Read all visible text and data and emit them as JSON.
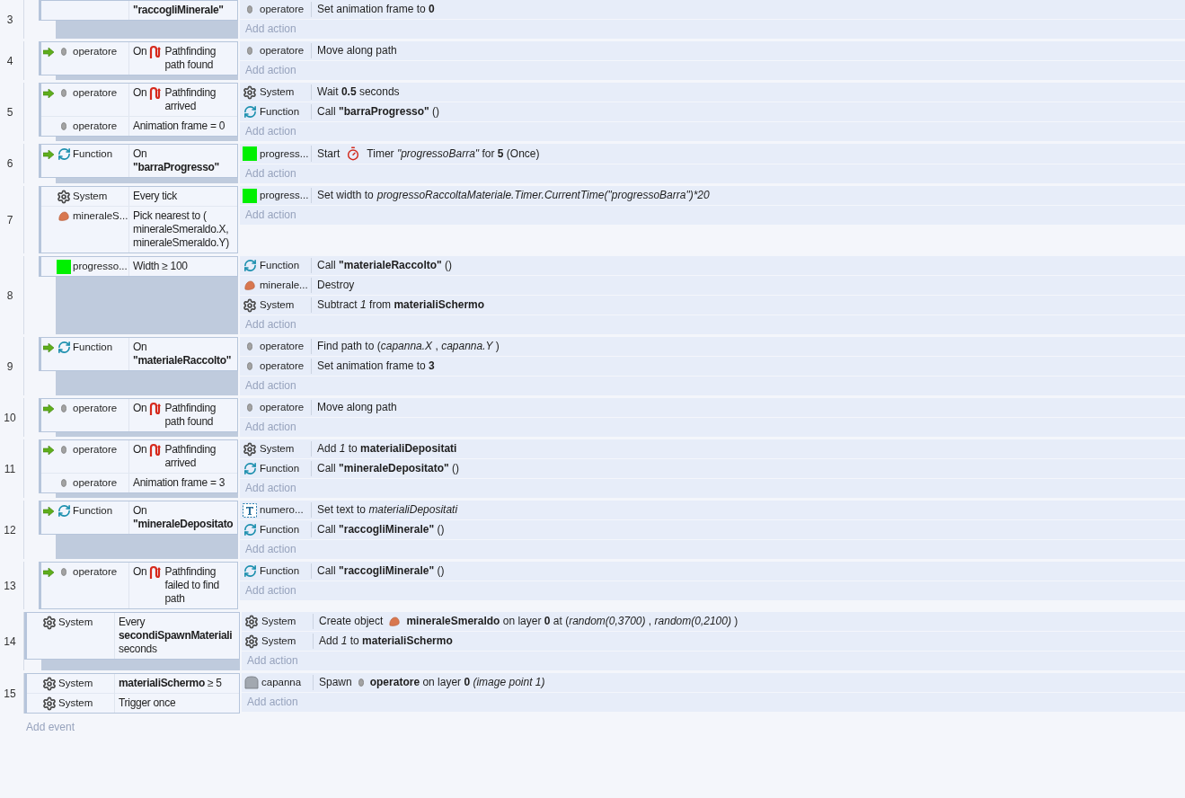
{
  "sub_events": [
    {
      "number": "3",
      "trigger": false,
      "conditions": [
        {
          "segments": [
            {
              "kind": "text",
              "text": "**\"raccogliMinerale\"**"
            }
          ]
        }
      ],
      "actions": [
        {
          "kind": "sprite",
          "object": "operatore",
          "segments": [
            {
              "kind": "text",
              "text": "Set animation frame to **0**"
            }
          ]
        }
      ],
      "add_action": "Add action"
    },
    {
      "number": "4",
      "trigger": true,
      "conditions": [
        {
          "kind": "sprite",
          "object": "operatore",
          "segments": [
            {
              "kind": "text",
              "text": "On"
            },
            {
              "kind": "pathfinding"
            },
            {
              "kind": "text",
              "text": "Pathfinding path found"
            }
          ]
        }
      ],
      "actions": [
        {
          "kind": "sprite",
          "object": "operatore",
          "segments": [
            {
              "kind": "text",
              "text": "Move along path"
            }
          ]
        }
      ],
      "add_action": "Add action"
    },
    {
      "number": "5",
      "trigger": true,
      "conditions": [
        {
          "kind": "sprite",
          "object": "operatore",
          "segments": [
            {
              "kind": "text",
              "text": "On"
            },
            {
              "kind": "pathfinding"
            },
            {
              "kind": "text",
              "text": "Pathfinding arrived"
            }
          ]
        },
        {
          "kind": "sprite",
          "object": "operatore",
          "segments": [
            {
              "kind": "text",
              "text": "Animation frame = 0"
            }
          ]
        }
      ],
      "actions": [
        {
          "kind": "system",
          "object": "System",
          "segments": [
            {
              "kind": "text",
              "text": "Wait **0.5** seconds"
            }
          ]
        },
        {
          "kind": "function",
          "object": "Function",
          "segments": [
            {
              "kind": "text",
              "text": "Call **\"barraProgresso\"** ()"
            }
          ]
        }
      ],
      "add_action": "Add action"
    },
    {
      "number": "6",
      "trigger": true,
      "conditions": [
        {
          "kind": "function",
          "object": "Function",
          "segments": [
            {
              "kind": "text",
              "text": "On **\"barraProgresso\"**"
            }
          ]
        }
      ],
      "actions": [
        {
          "kind": "bar",
          "object": "progress...",
          "segments": [
            {
              "kind": "text",
              "text": "Start"
            },
            {
              "kind": "timer"
            },
            {
              "kind": "text",
              "text": "Timer *\"progressoBarra\"* for **5** (Once)"
            }
          ]
        }
      ],
      "add_action": "Add action"
    },
    {
      "number": "7",
      "trigger": false,
      "conditions": [
        {
          "kind": "system",
          "object": "System",
          "segments": [
            {
              "kind": "text",
              "text": "Every tick"
            }
          ]
        },
        {
          "kind": "mineral",
          "object": "mineraleS...",
          "segments": [
            {
              "kind": "text",
              "text": "Pick nearest to ( mineraleSmeraldo.X, mineraleSmeraldo.Y)"
            }
          ]
        }
      ],
      "actions": [
        {
          "kind": "bar",
          "object": "progress...",
          "segments": [
            {
              "kind": "text",
              "text": "Set width to"
            },
            {
              "kind": "expr",
              "text": "progressoRaccoltaMateriale.Timer.CurrentTime(\"progressoBarra\")*20"
            }
          ]
        }
      ],
      "add_action": "Add action"
    },
    {
      "number": "8",
      "trigger": false,
      "conditions": [
        {
          "kind": "bar",
          "object": "progresso...",
          "segments": [
            {
              "kind": "text",
              "text": "Width ≥ 100"
            }
          ]
        }
      ],
      "actions": [
        {
          "kind": "function",
          "object": "Function",
          "segments": [
            {
              "kind": "text",
              "text": "Call **\"materialeRaccolto\"** ()"
            }
          ]
        },
        {
          "kind": "mineral",
          "object": "minerale...",
          "segments": [
            {
              "kind": "text",
              "text": "Destroy"
            }
          ]
        },
        {
          "kind": "system",
          "object": "System",
          "segments": [
            {
              "kind": "text",
              "text": "Subtract *1* from **materialiSchermo**"
            }
          ]
        }
      ],
      "add_action": "Add action"
    },
    {
      "number": "9",
      "trigger": true,
      "conditions": [
        {
          "kind": "function",
          "object": "Function",
          "segments": [
            {
              "kind": "text",
              "text": "On **\"materialeRaccolto\"**"
            }
          ]
        }
      ],
      "actions": [
        {
          "kind": "sprite",
          "object": "operatore",
          "segments": [
            {
              "kind": "text",
              "text": "Find path to (*capanna.X* , *capanna.Y* )"
            }
          ]
        },
        {
          "kind": "sprite",
          "object": "operatore",
          "segments": [
            {
              "kind": "text",
              "text": "Set animation frame to **3**"
            }
          ]
        }
      ],
      "add_action": "Add action"
    },
    {
      "number": "10",
      "trigger": true,
      "conditions": [
        {
          "kind": "sprite",
          "object": "operatore",
          "segments": [
            {
              "kind": "text",
              "text": "On"
            },
            {
              "kind": "pathfinding"
            },
            {
              "kind": "text",
              "text": "Pathfinding path found"
            }
          ]
        }
      ],
      "actions": [
        {
          "kind": "sprite",
          "object": "operatore",
          "segments": [
            {
              "kind": "text",
              "text": "Move along path"
            }
          ]
        }
      ],
      "add_action": "Add action"
    },
    {
      "number": "11",
      "trigger": true,
      "conditions": [
        {
          "kind": "sprite",
          "object": "operatore",
          "segments": [
            {
              "kind": "text",
              "text": "On"
            },
            {
              "kind": "pathfinding"
            },
            {
              "kind": "text",
              "text": "Pathfinding arrived"
            }
          ]
        },
        {
          "kind": "sprite",
          "object": "operatore",
          "segments": [
            {
              "kind": "text",
              "text": "Animation frame = 3"
            }
          ]
        }
      ],
      "actions": [
        {
          "kind": "system",
          "object": "System",
          "segments": [
            {
              "kind": "text",
              "text": "Add *1* to **materialiDepositati**"
            }
          ]
        },
        {
          "kind": "function",
          "object": "Function",
          "segments": [
            {
              "kind": "text",
              "text": "Call **\"mineraleDepositato\"** ()"
            }
          ]
        }
      ],
      "add_action": "Add action"
    },
    {
      "number": "12",
      "trigger": true,
      "conditions": [
        {
          "kind": "function",
          "object": "Function",
          "segments": [
            {
              "kind": "text",
              "text": "On **\"mineraleDepositato**"
            }
          ]
        }
      ],
      "actions": [
        {
          "kind": "textobj",
          "object": "numero...",
          "segments": [
            {
              "kind": "text",
              "text": "Set text to *materialiDepositati*"
            }
          ]
        },
        {
          "kind": "function",
          "object": "Function",
          "segments": [
            {
              "kind": "text",
              "text": "Call **\"raccogliMinerale\"** ()"
            }
          ]
        }
      ],
      "add_action": "Add action"
    },
    {
      "number": "13",
      "trigger": true,
      "conditions": [
        {
          "kind": "sprite",
          "object": "operatore",
          "segments": [
            {
              "kind": "text",
              "text": "On"
            },
            {
              "kind": "pathfinding"
            },
            {
              "kind": "text",
              "text": "Pathfinding failed to find path"
            }
          ]
        }
      ],
      "actions": [
        {
          "kind": "function",
          "object": "Function",
          "segments": [
            {
              "kind": "text",
              "text": "Call **\"raccogliMinerale\"** ()"
            }
          ]
        }
      ],
      "add_action": "Add action"
    }
  ],
  "events": [
    {
      "number": "14",
      "trigger": false,
      "conditions": [
        {
          "kind": "system",
          "object": "System",
          "segments": [
            {
              "kind": "text",
              "text": "Every **secondiSpawnMateriali** seconds"
            }
          ]
        }
      ],
      "actions": [
        {
          "kind": "system",
          "object": "System",
          "segments": [
            {
              "kind": "text",
              "text": "Create object"
            },
            {
              "kind": "mineral"
            },
            {
              "kind": "text",
              "text": "**mineraleSmeraldo** on layer **0** at (*random(0,3700)* , *random(0,2100)* )"
            }
          ]
        },
        {
          "kind": "system",
          "object": "System",
          "segments": [
            {
              "kind": "text",
              "text": "Add *1* to **materialiSchermo**"
            }
          ]
        }
      ],
      "add_action": "Add action"
    },
    {
      "number": "15",
      "trigger": false,
      "conditions": [
        {
          "kind": "system",
          "object": "System",
          "segments": [
            {
              "kind": "text",
              "text": "**materialiSchermo** ≥ 5"
            }
          ]
        },
        {
          "kind": "system",
          "object": "System",
          "segments": [
            {
              "kind": "text",
              "text": "Trigger once"
            }
          ]
        }
      ],
      "actions": [
        {
          "kind": "building",
          "object": "capanna",
          "segments": [
            {
              "kind": "text",
              "text": "Spawn"
            },
            {
              "kind": "sprite"
            },
            {
              "kind": "text",
              "text": "**operatore** on layer **0** *(image point 1)*"
            }
          ]
        }
      ],
      "add_action": "Add action"
    }
  ],
  "add_event": "Add event"
}
